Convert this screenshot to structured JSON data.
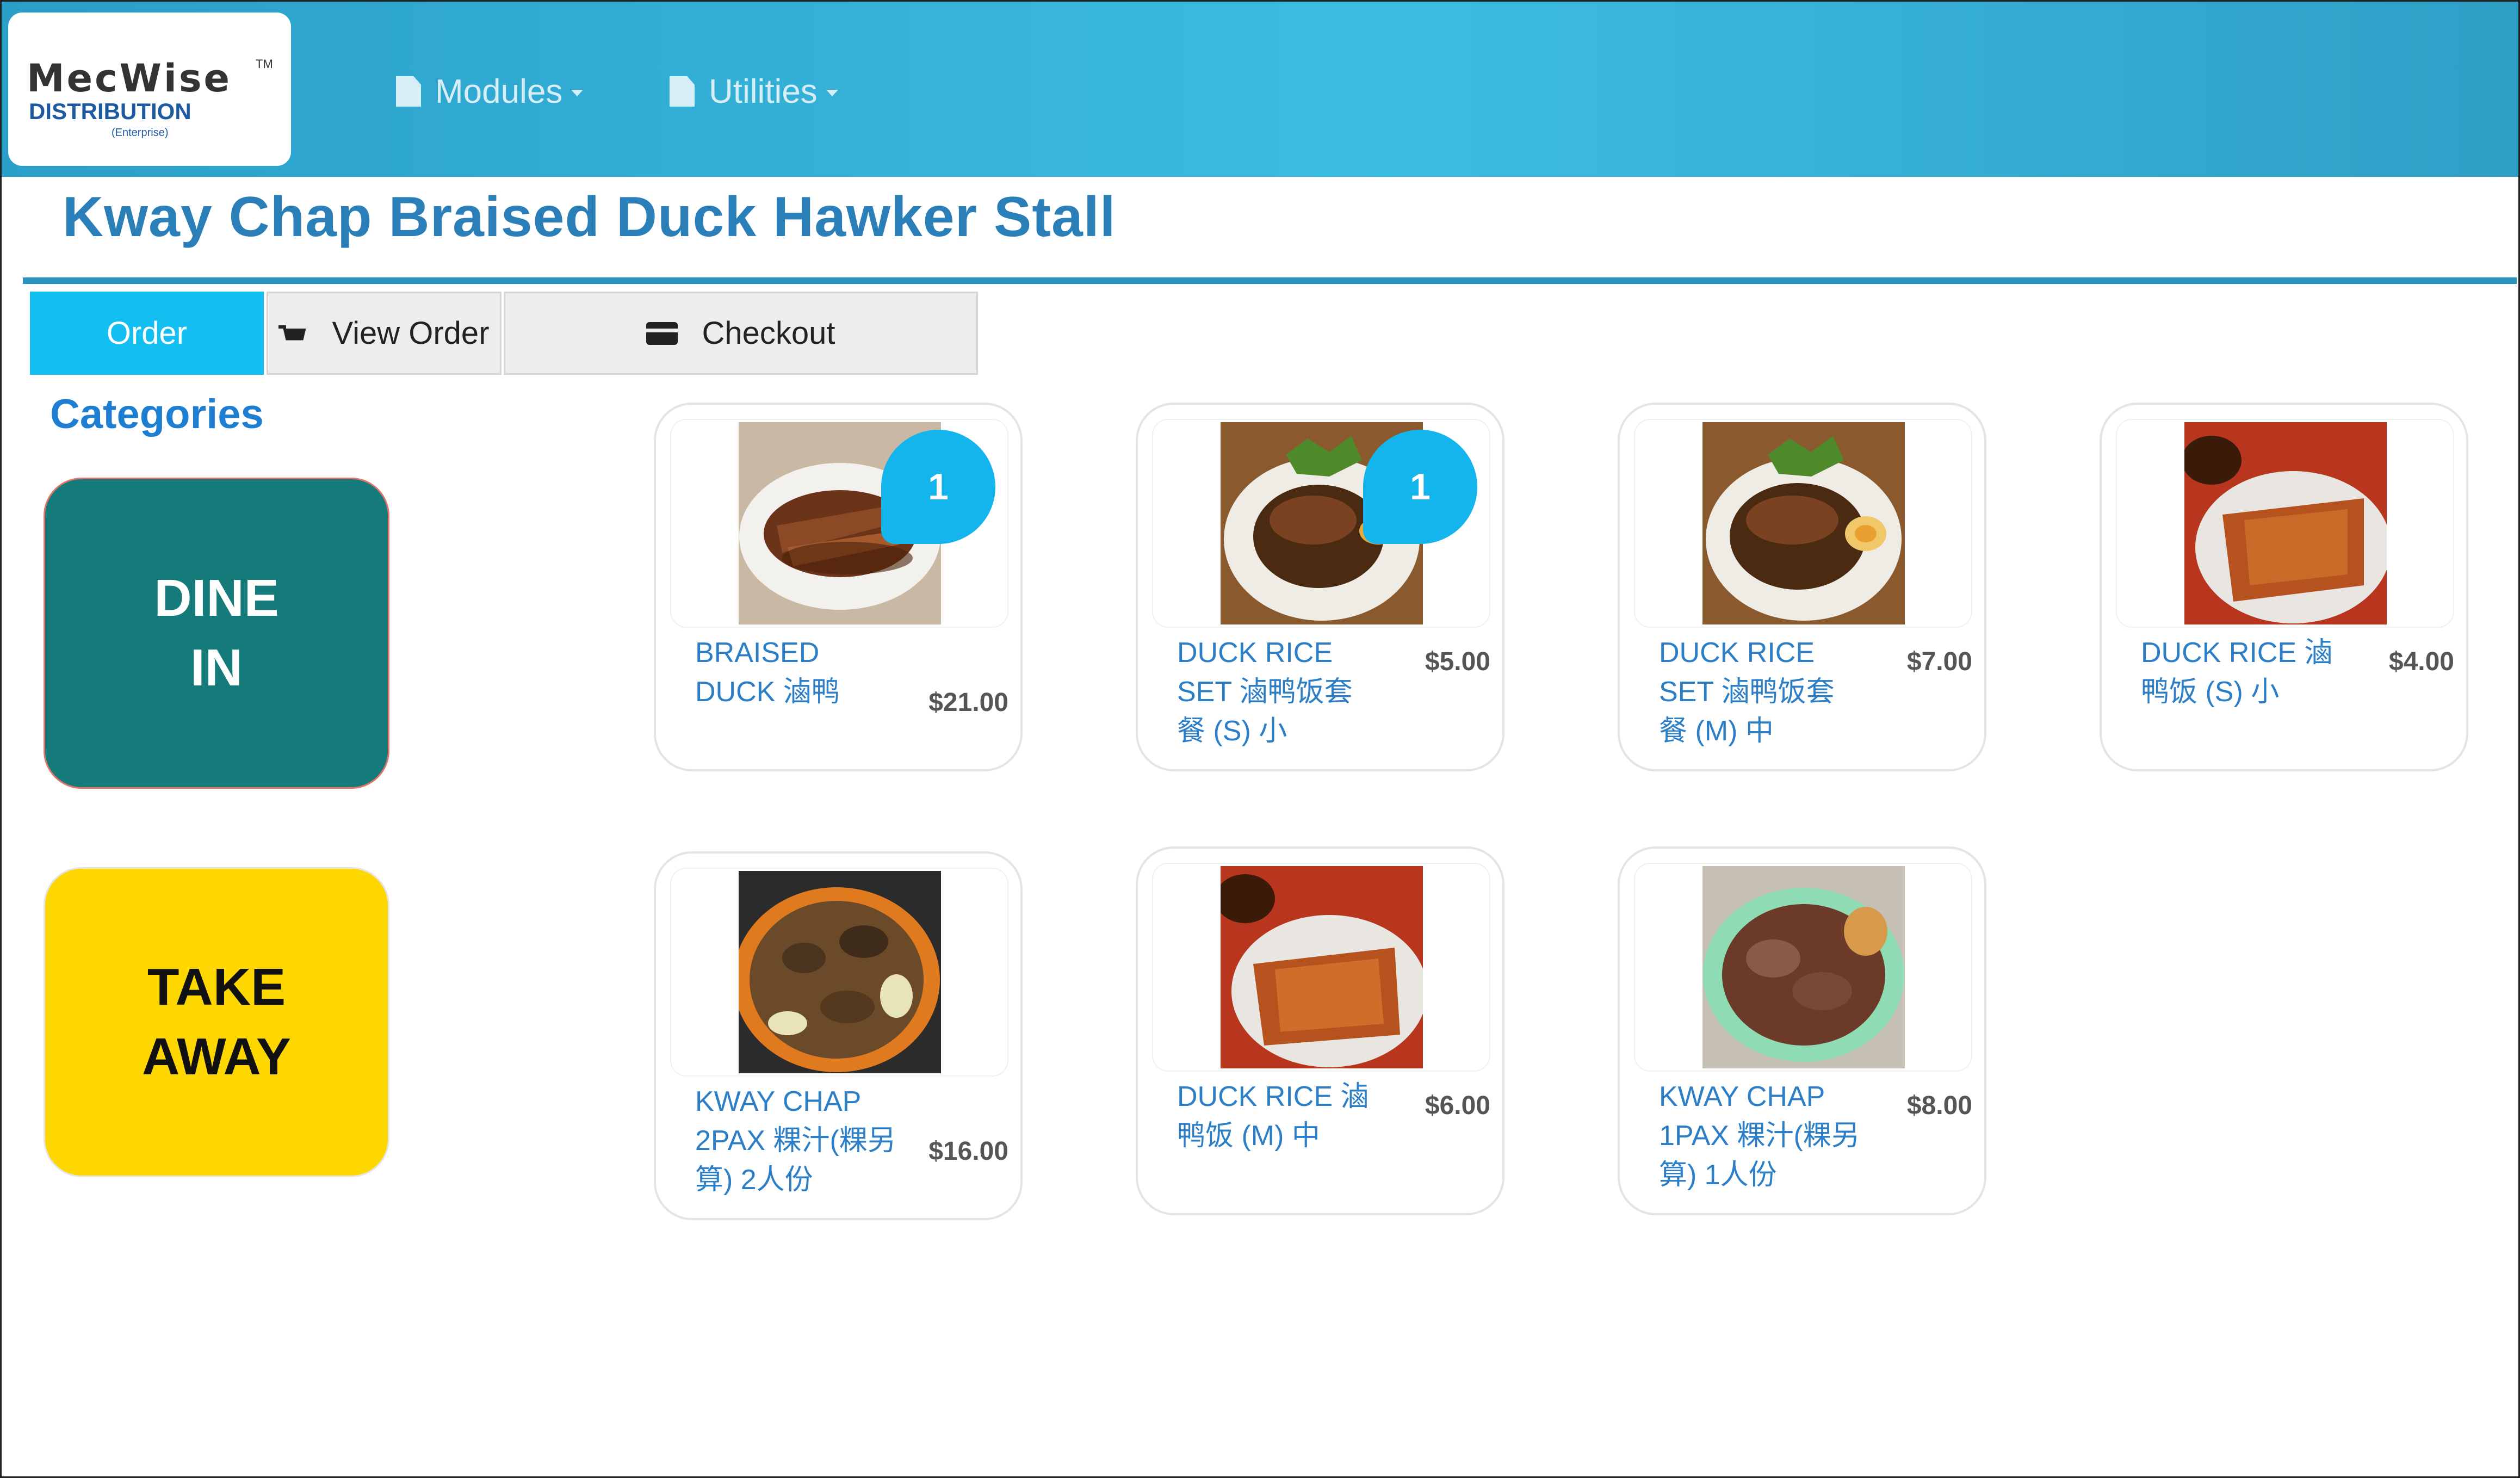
{
  "header": {
    "logo": {
      "word": "MecWise",
      "tm": "TM",
      "sub": "DISTRIBUTION",
      "edition": "(Enterprise)"
    },
    "nav": [
      {
        "label": "Modules",
        "icon": "document-icon"
      },
      {
        "label": "Utilities",
        "icon": "document-icon"
      }
    ]
  },
  "page": {
    "title": "Kway Chap Braised Duck Hawker Stall"
  },
  "tabs": [
    {
      "label": "Order",
      "active": true
    },
    {
      "label": "View Order",
      "icon": "cart-icon"
    },
    {
      "label": "Checkout",
      "icon": "credit-card-icon"
    }
  ],
  "categories": {
    "heading": "Categories",
    "items": [
      {
        "line1": "DINE",
        "line2": "IN",
        "color": "#157a7a"
      },
      {
        "line1": "TAKE",
        "line2": "AWAY",
        "color": "#ffd700"
      }
    ]
  },
  "products": [
    {
      "name": "BRAISED DUCK 滷鸭",
      "price": "$21.00",
      "qty": "1"
    },
    {
      "name": "DUCK RICE SET 滷鸭饭套餐 (S) 小",
      "price": "$5.00",
      "qty": "1"
    },
    {
      "name": "DUCK RICE SET 滷鸭饭套餐 (M) 中",
      "price": "$7.00"
    },
    {
      "name": "DUCK RICE 滷鸭饭 (S) 小",
      "price": "$4.00"
    },
    {
      "name": "KWAY CHAP 2PAX 粿汁(粿另算) 2人份",
      "price": "$16.00"
    },
    {
      "name": "DUCK RICE 滷鸭饭 (M) 中",
      "price": "$6.00"
    },
    {
      "name": "KWAY CHAP 1PAX 粿汁(粿另算) 1人份",
      "price": "$8.00"
    }
  ],
  "colors": {
    "header": "#35b3de",
    "accent": "#12bff0",
    "title": "#2b7fb9",
    "badge": "#14b4ec"
  }
}
